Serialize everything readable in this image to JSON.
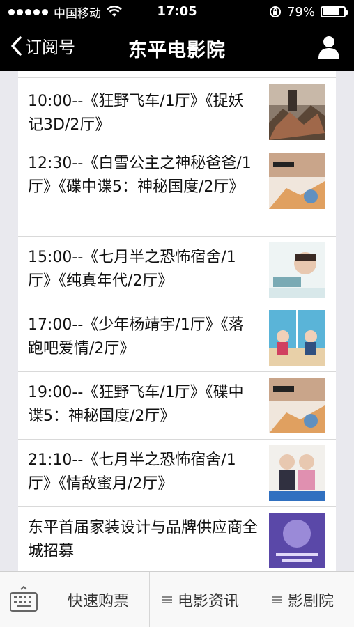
{
  "status_bar": {
    "carrier": "中国移动",
    "time": "17:05",
    "battery_label": "79%",
    "battery_level": 0.79
  },
  "nav": {
    "back_label": "订阅号",
    "title": "东平电影院"
  },
  "schedule": [
    {
      "text": "10:00--《狂野飞车/1厅》《捉妖记3D/2厅》"
    },
    {
      "text": "12:30--《白雪公主之神秘爸爸/1厅》《碟中谍5：神秘国度/2厅》"
    },
    {
      "text": "15:00--《七月半之恐怖宿舍/1厅》《纯真年代/2厅》"
    },
    {
      "text": "17:00--《少年杨靖宇/1厅》《落跑吧爱情/2厅》"
    },
    {
      "text": "19:00--《狂野飞车/1厅》《碟中谍5：神秘国度/2厅》"
    },
    {
      "text": "21:10--《七月半之恐怖宿舍/1厅》《情敌蜜月/2厅》"
    },
    {
      "text": "东平首届家装设计与品牌供应商全城招募"
    }
  ],
  "bottom_menu": {
    "items": [
      "快速购票",
      "电影资讯",
      "影剧院"
    ]
  },
  "colors": {
    "bar": "#000000",
    "page_bg": "#e9e9ee",
    "card_bg": "#ffffff",
    "divider": "#d9d9d9"
  }
}
